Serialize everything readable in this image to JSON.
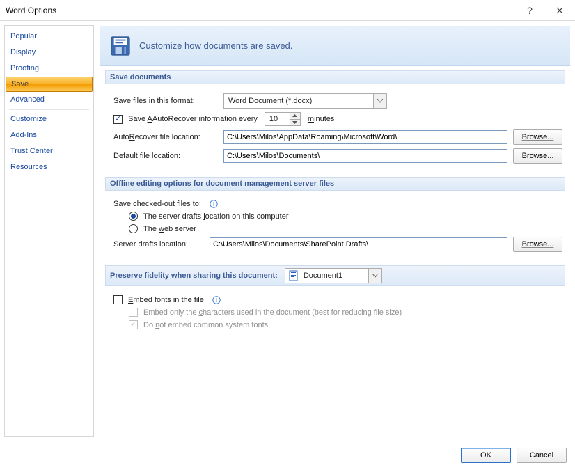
{
  "window": {
    "title": "Word Options"
  },
  "sidebar": {
    "items": [
      {
        "label": "Popular"
      },
      {
        "label": "Display"
      },
      {
        "label": "Proofing"
      },
      {
        "label": "Save",
        "selected": true
      },
      {
        "label": "Advanced"
      },
      {
        "label": "Customize"
      },
      {
        "label": "Add-Ins"
      },
      {
        "label": "Trust Center"
      },
      {
        "label": "Resources"
      }
    ]
  },
  "header": {
    "text": "Customize how documents are saved."
  },
  "section_save_docs": {
    "title": "Save documents",
    "save_format_label": "Save files in this format:",
    "save_format_value": "Word Document (*.docx)",
    "autorecover_label_a": "Save ",
    "autorecover_label_b": "AutoRecover information every",
    "autorecover_value": "10",
    "autorecover_unit": "minutes",
    "autorecover_loc_label": "AutoRecover file location:",
    "autorecover_loc_value": "C:\\Users\\Milos\\AppData\\Roaming\\Microsoft\\Word\\",
    "default_loc_label": "Default file location:",
    "default_loc_value": "C:\\Users\\Milos\\Documents\\",
    "browse_label": "Browse..."
  },
  "section_offline": {
    "title": "Offline editing options for document management server files",
    "checkedout_label": "Save checked-out files to:",
    "radio_server_drafts": "The server drafts location on this computer",
    "radio_web_server": "The web server",
    "server_drafts_label": "Server drafts location:",
    "server_drafts_value": "C:\\Users\\Milos\\Documents\\SharePoint Drafts\\",
    "browse_label": "Browse..."
  },
  "section_preserve": {
    "title": "Preserve fidelity when sharing this document:",
    "doc_selected": "Document1",
    "embed_fonts_label": "Embed fonts in the file",
    "embed_only_label": "Embed only the characters used in the document (best for reducing file size)",
    "no_common_label": "Do not embed common system fonts"
  },
  "footer": {
    "ok": "OK",
    "cancel": "Cancel"
  }
}
